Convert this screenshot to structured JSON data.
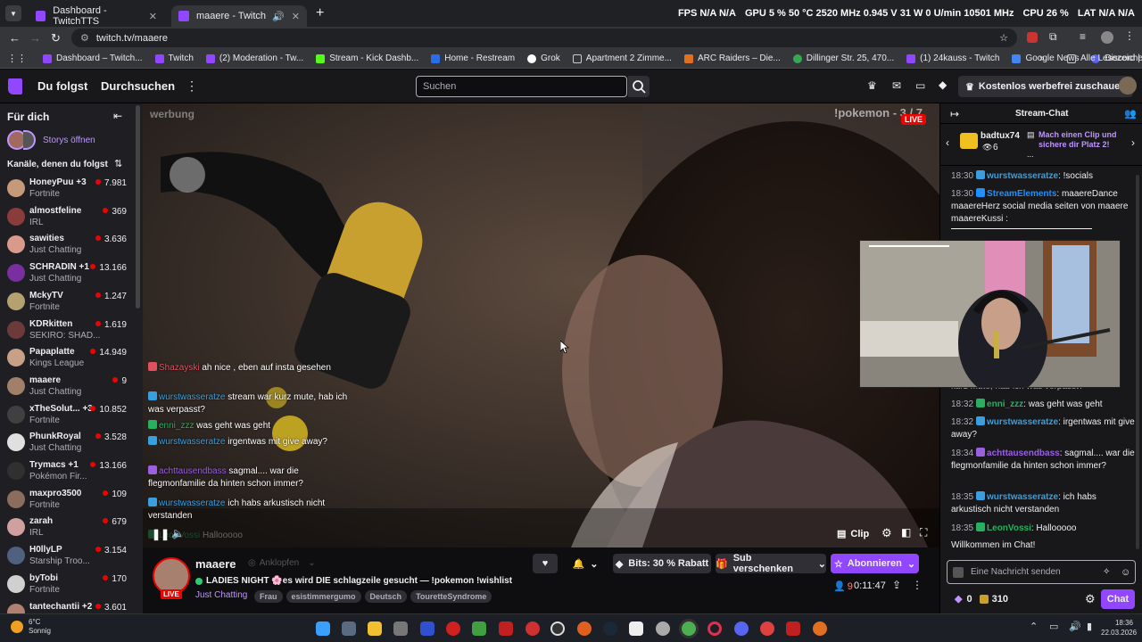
{
  "browser": {
    "tabs": [
      {
        "label": "Dashboard - TwitchTTS",
        "active": false
      },
      {
        "label": "maaere - Twitch",
        "active": true
      }
    ],
    "url": "twitch.tv/maaere",
    "sysstats": [
      "FPS N/A N/A",
      "GPU 5 % 50 °C 2520 MHz 0.945 V 31 W 0 U/min 10501 MHz",
      "CPU 26 %",
      "LAT N/A N/A"
    ],
    "bookmarks": [
      "Dashboard – Twitch...",
      "Twitch",
      "(2) Moderation - Tw...",
      "Stream - Kick Dashb...",
      "Home - Restream",
      "Grok",
      "Apartment 2 Zimme...",
      "ARC Raiders – Die...",
      "Dillinger Str. 25, 470...",
      "(1) 24kauss - Twitch",
      "Google News",
      "Discord | #allgeme..."
    ],
    "all_bookmarks": "Alle Lesezeichen"
  },
  "twitch": {
    "nav_following": "Du folgst",
    "nav_browse": "Durchsuchen",
    "search_placeholder": "Suchen",
    "adfree": "Kostenlos werbefrei zuschauen"
  },
  "sidebar": {
    "title": "Für dich",
    "stories": "Storys öffnen",
    "followed": "Kanäle, denen du folgst",
    "channels": [
      {
        "name": "HoneyPuu +3",
        "game": "Fortnite",
        "viewers": "7.981",
        "color": "#c49a7a"
      },
      {
        "name": "almostfeline",
        "game": "IRL",
        "viewers": "369",
        "color": "#8a3c3c"
      },
      {
        "name": "sawities",
        "game": "Just Chatting",
        "viewers": "3.636",
        "color": "#d99a8c"
      },
      {
        "name": "SCHRADIN +1",
        "game": "Just Chatting",
        "viewers": "13.166",
        "color": "#7a2fa0"
      },
      {
        "name": "MckyTV",
        "game": "Fortnite",
        "viewers": "1.247",
        "color": "#b5a070"
      },
      {
        "name": "KDRkitten",
        "game": "SEKIRO: SHAD...",
        "viewers": "1.619",
        "color": "#6c3a3a"
      },
      {
        "name": "Papaplatte",
        "game": "Kings League",
        "viewers": "14.949",
        "color": "#c8a088"
      },
      {
        "name": "maaere",
        "game": "Just Chatting",
        "viewers": "9",
        "color": "#a08068"
      },
      {
        "name": "xTheSolut... +3",
        "game": "Fortnite",
        "viewers": "10.852",
        "color": "#404040"
      },
      {
        "name": "PhunkRoyal",
        "game": "Just Chatting",
        "viewers": "3.528",
        "color": "#e0e0e0"
      },
      {
        "name": "Trymacs +1",
        "game": "Pokémon Fir...",
        "viewers": "13.166",
        "color": "#303030"
      },
      {
        "name": "maxpro3500",
        "game": "Fortnite",
        "viewers": "109",
        "color": "#8c6c5c"
      },
      {
        "name": "zarah",
        "game": "IRL",
        "viewers": "679",
        "color": "#d0a0a0"
      },
      {
        "name": "H0llyLP",
        "game": "Starship Troo...",
        "viewers": "3.154",
        "color": "#506080"
      },
      {
        "name": "byTobi",
        "game": "Fortnite",
        "viewers": "170",
        "color": "#d0d0d0"
      },
      {
        "name": "tantechantii +2",
        "game": "Fortnite",
        "viewers": "3.601",
        "color": "#b08070"
      }
    ]
  },
  "video": {
    "ad_label": "werbung",
    "overlay_cmd": "!pokemon - 3 / 7",
    "live": "LIVE",
    "clip": "Clip",
    "overlay_chat": [
      {
        "user": "Shazayski",
        "text": "ah nice , eben auf insta gesehen",
        "color": "#e2505f"
      },
      {
        "user": "wurstwasseratze",
        "text": "stream war kurz mute, hab ich was verpasst?",
        "color": "#38a0e0"
      },
      {
        "user": "enni_zzz",
        "text": "was geht was geht",
        "color": "#28b060"
      },
      {
        "user": "wurstwasseratze",
        "text": "irgentwas mit give away?",
        "color": "#38a0e0"
      },
      {
        "user": "achttausendbass",
        "text": "sagmal.... war die flegmonfamilie da hinten schon immer?",
        "color": "#9a60e0"
      },
      {
        "user": "wurstwasseratze",
        "text": "ich habs arkustisch nicht verstanden",
        "color": "#38a0e0"
      },
      {
        "user": "LeonVossi",
        "text": "Hallooooo",
        "color": "#28b060"
      }
    ]
  },
  "stream": {
    "channel": "maaere",
    "report": "Anklopfen",
    "title": "LADIES NIGHT 🌸es wird DIE schlagzeile gesucht — !pokemon !wishlist",
    "category": "Just Chatting",
    "tags": [
      "Frau",
      "esistimmergumo",
      "Deutsch",
      "TouretteSyndrome"
    ],
    "live": "LIVE",
    "bits": "Bits: 30 % Rabatt",
    "gift": "Sub verschenken",
    "subscribe": "Abonnieren",
    "viewers": "9",
    "uptime": "0:11:47"
  },
  "chat": {
    "title": "Stream-Chat",
    "hype_user": "badtux74",
    "hype_count": "6",
    "hype_msg": "Mach einen Clip und sichere dir Platz 2!",
    "hype_more": "...",
    "messages": [
      {
        "time": "18:30",
        "user": "wurstwasseratze",
        "text": ": !socials",
        "color": "#38a0e0"
      },
      {
        "time": "18:30",
        "user": "StreamElements",
        "text": ": maaereDance maaereHerz social media seiten von maaere maaereKussi :",
        "color": "#1e90ff"
      },
      {
        "time": "",
        "user": "",
        "text": "kurz mute, hab ich was verpasst?",
        "color": "#adadb8"
      },
      {
        "time": "18:32",
        "user": "enni_zzz",
        "text": ": was geht was geht",
        "color": "#28b060"
      },
      {
        "time": "18:32",
        "user": "wurstwasseratze",
        "text": ": irgentwas mit give away?",
        "color": "#38a0e0"
      },
      {
        "time": "18:34",
        "user": "achttausendbass",
        "text": ": sagmal.... war die flegmonfamilie da hinten schon immer?",
        "color": "#9a60e0"
      },
      {
        "time": "18:35",
        "user": "wurstwasseratze",
        "text": ": ich habs arkustisch nicht verstanden",
        "color": "#38a0e0"
      },
      {
        "time": "18:35",
        "user": "LeonVossi",
        "text": ": Hallooooo",
        "color": "#28b060"
      },
      {
        "time": "",
        "user": "",
        "text": "Willkommen im Chat!",
        "color": "#efeff1"
      }
    ],
    "input_placeholder": "Eine Nachricht senden",
    "points": "0",
    "bits_count": "310",
    "send": "Chat"
  },
  "taskbar": {
    "weather_temp": "6°C",
    "weather_desc": "Sonnig",
    "time": "18:36",
    "date": "22.03.2026"
  },
  "colors": {
    "twitch_purple": "#9147ff",
    "live_red": "#eb0400"
  }
}
